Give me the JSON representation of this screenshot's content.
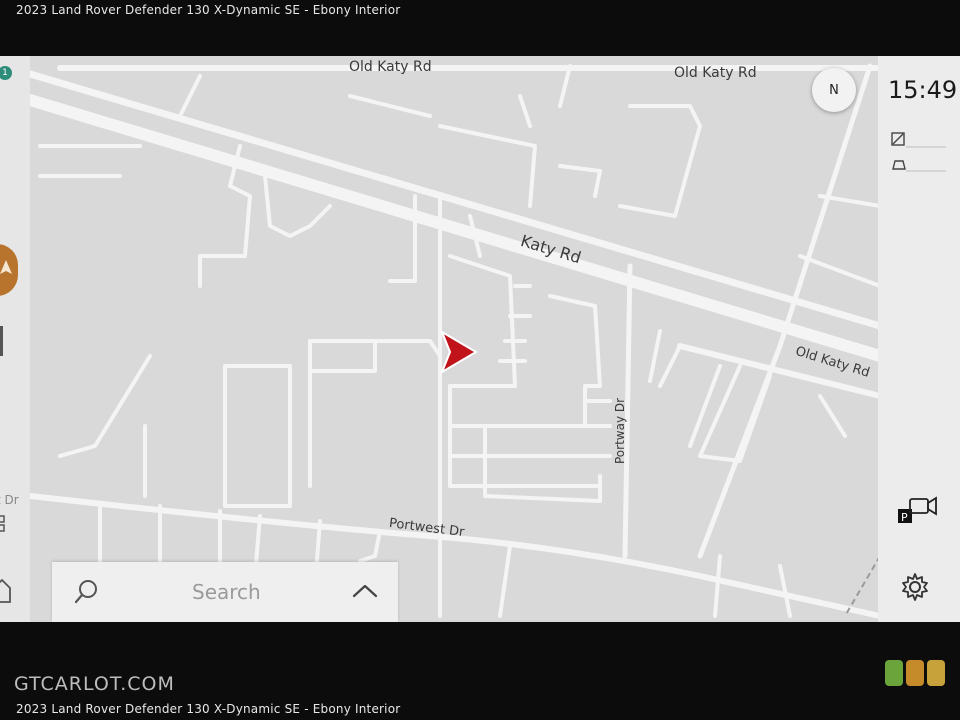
{
  "caption": "2023 Land Rover Defender 130 X-Dynamic SE - Ebony Interior",
  "clock": "15:49",
  "compass": "N",
  "search": {
    "placeholder": "Search"
  },
  "watermark": "GTCARLOT.COM",
  "left_rail": {
    "badge": "1",
    "partial_label": "t Dr"
  },
  "roads": [
    {
      "id": "old-katy-rd-1",
      "text": "Old Katy Rd"
    },
    {
      "id": "old-katy-rd-2",
      "text": "Old Katy Rd"
    },
    {
      "id": "katy-rd",
      "text": "Katy Rd"
    },
    {
      "id": "old-katy-rd-3",
      "text": "Old Katy Rd"
    },
    {
      "id": "portway-dr",
      "text": "Portway Dr"
    },
    {
      "id": "portwest-dr",
      "text": "Portwest Dr"
    }
  ],
  "icons": {
    "position": "navigation-arrow-icon",
    "search": "search-icon",
    "expand": "chevron-up-icon",
    "camera": "parking-camera-icon",
    "settings": "gear-icon",
    "home": "home-icon"
  },
  "colors": {
    "arrow": "#c0141a",
    "accent": "#b8742c",
    "map_bg": "#d9d9d9",
    "road": "#f4f4f4"
  }
}
